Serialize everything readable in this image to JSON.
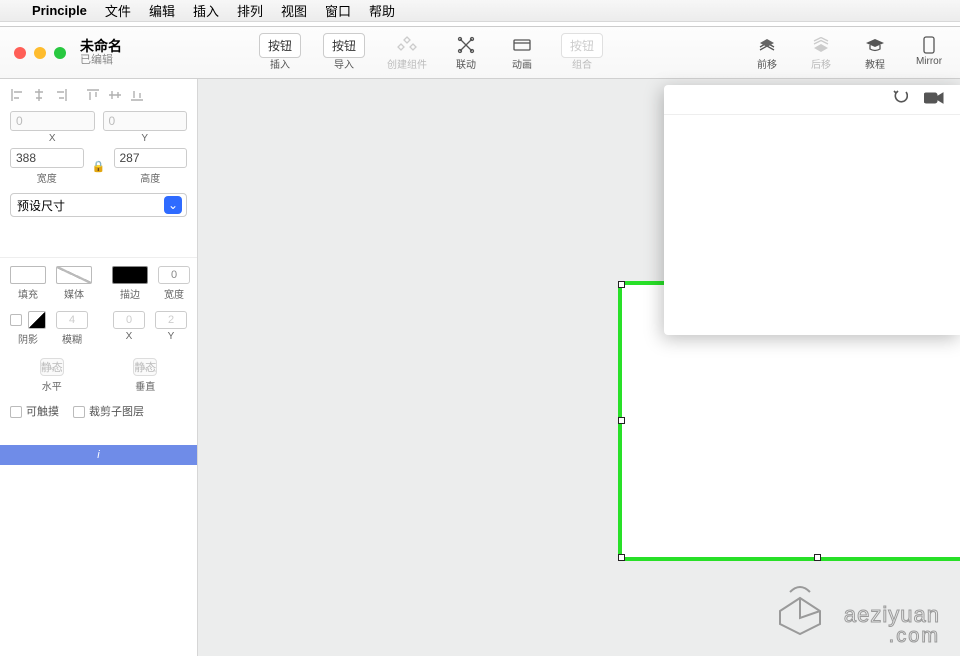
{
  "menubar": {
    "apple": "",
    "app": "Principle",
    "items": [
      "文件",
      "编辑",
      "插入",
      "排列",
      "视图",
      "窗口",
      "帮助"
    ]
  },
  "titlebar": {
    "doc_name": "未命名",
    "doc_status": "已编辑"
  },
  "toolbar": {
    "insert_btn": "按钮",
    "insert_lbl": "插入",
    "import_btn": "按钮",
    "import_lbl": "导入",
    "create_comp_lbl": "创建组件",
    "drivers_lbl": "联动",
    "animate_lbl": "动画",
    "group_btn": "按钮",
    "group_lbl": "组合",
    "forward_lbl": "前移",
    "backward_lbl": "后移",
    "tutorial_lbl": "教程",
    "mirror_lbl": "Mirror"
  },
  "inspector": {
    "x_value": "0",
    "y_value": "0",
    "x_lbl": "X",
    "y_lbl": "Y",
    "width_value": "388",
    "height_value": "287",
    "width_lbl": "宽度",
    "height_lbl": "高度",
    "preset_label": "预设尺寸",
    "fill_lbl": "填充",
    "media_lbl": "媒体",
    "stroke_lbl": "描边",
    "stroke_width_lbl": "宽度",
    "stroke_width_val": "0",
    "shadow_lbl": "阴影",
    "blur_lbl": "模糊",
    "blur_val": "4",
    "sx_lbl": "X",
    "sx_val": "0",
    "sy_lbl": "Y",
    "sy_val": "2",
    "h_static": "静态",
    "v_static": "静态",
    "h_lbl": "水平",
    "v_lbl": "垂直",
    "touchable_lbl": "可触摸",
    "clip_lbl": "裁剪子图层",
    "info_i": "i"
  },
  "watermark": {
    "line1": "aeziyuan",
    "line2": ".com"
  }
}
